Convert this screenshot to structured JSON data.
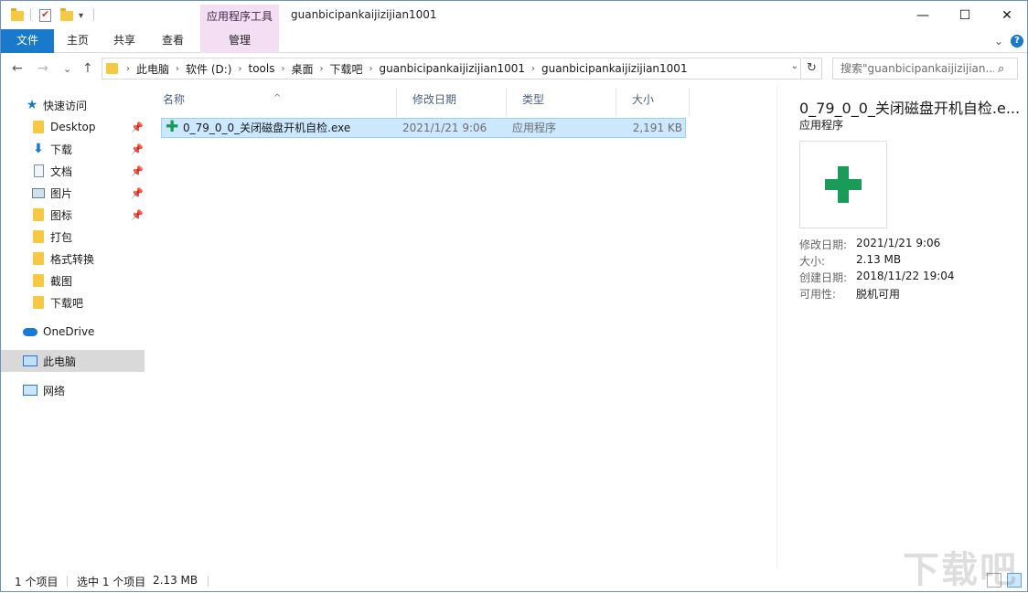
{
  "window": {
    "title": "guanbicipankaijizijian1001",
    "context_tab_header": "应用程序工具",
    "controls": {
      "minimize": "—",
      "maximize": "☐",
      "close": "✕"
    }
  },
  "ribbon": {
    "tabs": [
      "文件",
      "主页",
      "共享",
      "查看",
      "管理"
    ],
    "expand_glyph": "⌄",
    "help_glyph": "?"
  },
  "nav": {
    "back": "←",
    "forward": "→",
    "recent": "⌄",
    "up": "↑",
    "breadcrumb": [
      "此电脑",
      "软件 (D:)",
      "tools",
      "桌面",
      "下载吧",
      "guanbicipankaijizijian1001",
      "guanbicipankaijizijian1001"
    ],
    "refresh": "↻",
    "search_placeholder": "搜索\"guanbicipankaijizijian...",
    "search_glyph": "⌕"
  },
  "sidebar": {
    "quick_access": "快速访问",
    "pinned": [
      {
        "label": "Desktop",
        "icon": "folder-icon"
      },
      {
        "label": "下载",
        "icon": "download-icon"
      },
      {
        "label": "文档",
        "icon": "document-icon"
      },
      {
        "label": "图片",
        "icon": "picture-icon"
      },
      {
        "label": "图标",
        "icon": "folder-icon"
      }
    ],
    "folders": [
      "打包",
      "格式转换",
      "截图",
      "下载吧"
    ],
    "onedrive": "OneDrive",
    "this_pc": "此电脑",
    "network": "网络"
  },
  "columns": {
    "name": "名称",
    "modified": "修改日期",
    "type": "类型",
    "size": "大小"
  },
  "files": [
    {
      "name": "0_79_0_0_关闭磁盘开机自检.exe",
      "modified": "2021/1/21 9:06",
      "type": "应用程序",
      "size": "2,191 KB",
      "selected": true
    }
  ],
  "preview": {
    "title": "0_79_0_0_关闭磁盘开机自检.e...",
    "type": "应用程序",
    "details": [
      {
        "key": "修改日期:",
        "value": "2021/1/21 9:06"
      },
      {
        "key": "大小:",
        "value": "2.13 MB"
      },
      {
        "key": "创建日期:",
        "value": "2018/11/22 19:04"
      },
      {
        "key": "可用性:",
        "value": "脱机可用"
      }
    ]
  },
  "status": {
    "item_count": "1 个项目",
    "selection": "选中 1 个项目",
    "selection_size": "2.13 MB"
  },
  "watermark": "下载吧",
  "colors": {
    "accent": "#1979ca",
    "context_tab": "#f3def4",
    "selection": "#cce8ff",
    "exe_green": "#1a9b5a"
  }
}
